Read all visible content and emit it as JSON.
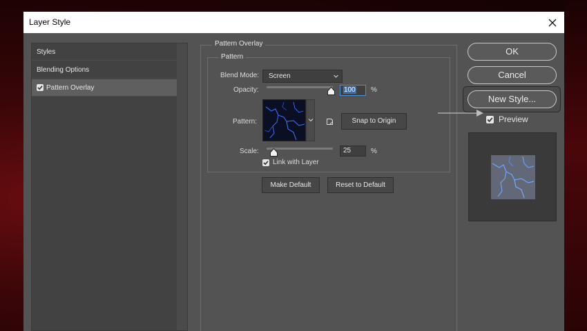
{
  "window": {
    "title": "Layer Style",
    "close_icon": "close-icon"
  },
  "styles_list": {
    "items": [
      {
        "label": "Styles",
        "checkbox": false,
        "selected": false
      },
      {
        "label": "Blending Options",
        "checkbox": false,
        "selected": false
      },
      {
        "label": "Pattern Overlay",
        "checkbox": true,
        "checked": true,
        "selected": true
      }
    ]
  },
  "panel": {
    "group_title": "Pattern Overlay",
    "subgroup_title": "Pattern",
    "blend_mode_label": "Blend Mode:",
    "blend_mode_value": "Screen",
    "opacity_label": "Opacity:",
    "opacity_value": "100",
    "opacity_unit": "%",
    "opacity_level": 1.0,
    "pattern_label": "Pattern:",
    "snap_to_origin": "Snap to Origin",
    "scale_label": "Scale:",
    "scale_value": "25",
    "scale_unit": "%",
    "scale_level": 0.08,
    "link_with_layer": "Link with Layer",
    "link_checked": true,
    "make_default": "Make Default",
    "reset_to_default": "Reset to Default"
  },
  "actions": {
    "ok": "OK",
    "cancel": "Cancel",
    "new_style": "New Style...",
    "preview_label": "Preview",
    "preview_checked": true
  },
  "colors": {
    "dialog_bg": "#535353",
    "accent_blue": "#3a6fb5",
    "pattern_line": "#3d6cff"
  }
}
